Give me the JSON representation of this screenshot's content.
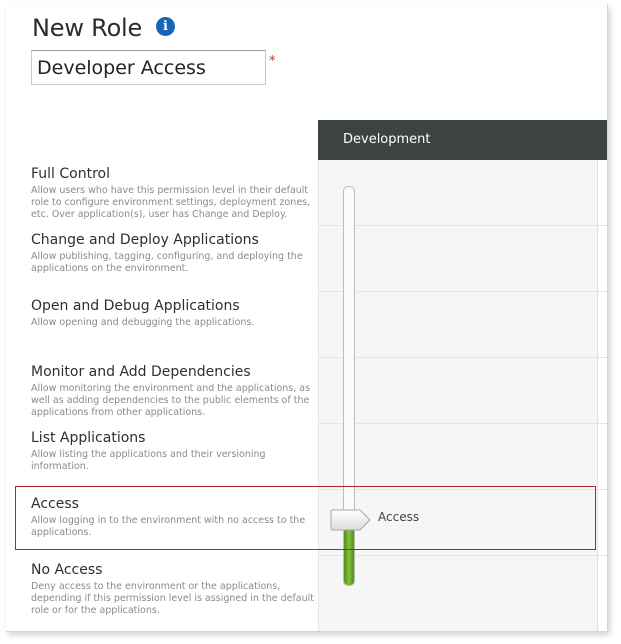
{
  "header": {
    "title": "New Role",
    "role_name_value": "Developer Access",
    "required_mark": "*"
  },
  "environment": {
    "column_label": "Development"
  },
  "permissions": [
    {
      "title": "Full Control",
      "description": "Allow users who have this permission level in their default role to configure environment settings, deployment zones, etc. Over application(s), user has Change and Deploy."
    },
    {
      "title": "Change and Deploy Applications",
      "description": "Allow publishing, tagging, configuring, and deploying the applications on the environment."
    },
    {
      "title": "Open and Debug Applications",
      "description": "Allow opening and debugging the applications."
    },
    {
      "title": "Monitor and Add Dependencies",
      "description": "Allow monitoring the environment and the applications, as well as adding dependencies to the public elements of the applications from other applications."
    },
    {
      "title": "List Applications",
      "description": "Allow listing the applications and their versioning information."
    },
    {
      "title": "Access",
      "description": "Allow logging in to the environment with no access to the applications."
    },
    {
      "title": "No Access",
      "description": "Deny access to the environment or the applications, depending if this permission level is assigned in the default role or for the applications."
    }
  ],
  "slider": {
    "selected_label": "Access",
    "selected_level_index": 5,
    "levels_count": 7
  },
  "colors": {
    "header_bg": "#3c4342",
    "info_icon": "#1a64b7",
    "slider_fill": "#6aab24",
    "highlight_border": "#a52a2a",
    "required": "#c0392b"
  },
  "icons": {
    "info": "info-circle-icon"
  }
}
